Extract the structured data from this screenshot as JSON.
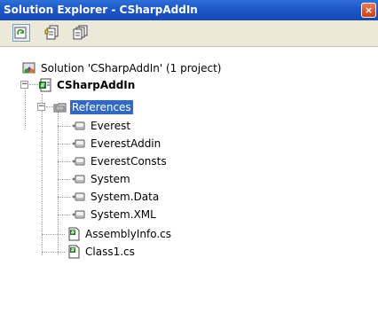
{
  "window": {
    "title": "Solution Explorer - CSharpAddIn",
    "close_glyph": "×"
  },
  "toolbar": {
    "buttons": [
      "refresh-icon",
      "properties-icon",
      "show-all-files-icon"
    ]
  },
  "tree": {
    "solution": {
      "label": "Solution 'CSharpAddIn' (1 project)",
      "icon": "solution-icon"
    },
    "project": {
      "label": "CSharpAddIn",
      "icon": "csharp-project-icon"
    },
    "references": {
      "label": "References",
      "icon": "references-folder-icon",
      "items": [
        "Everest",
        "EverestAddin",
        "EverestConsts",
        "System",
        "System.Data",
        "System.XML"
      ]
    },
    "files": [
      {
        "label": "AssemblyInfo.cs",
        "icon": "csharp-file-icon"
      },
      {
        "label": "Class1.cs",
        "icon": "csharp-file-icon"
      }
    ],
    "expander_minus": "−"
  },
  "colors": {
    "titlebar": "#1c56c8",
    "selection": "#316ac5",
    "toolbar_bg": "#ece9d8"
  }
}
